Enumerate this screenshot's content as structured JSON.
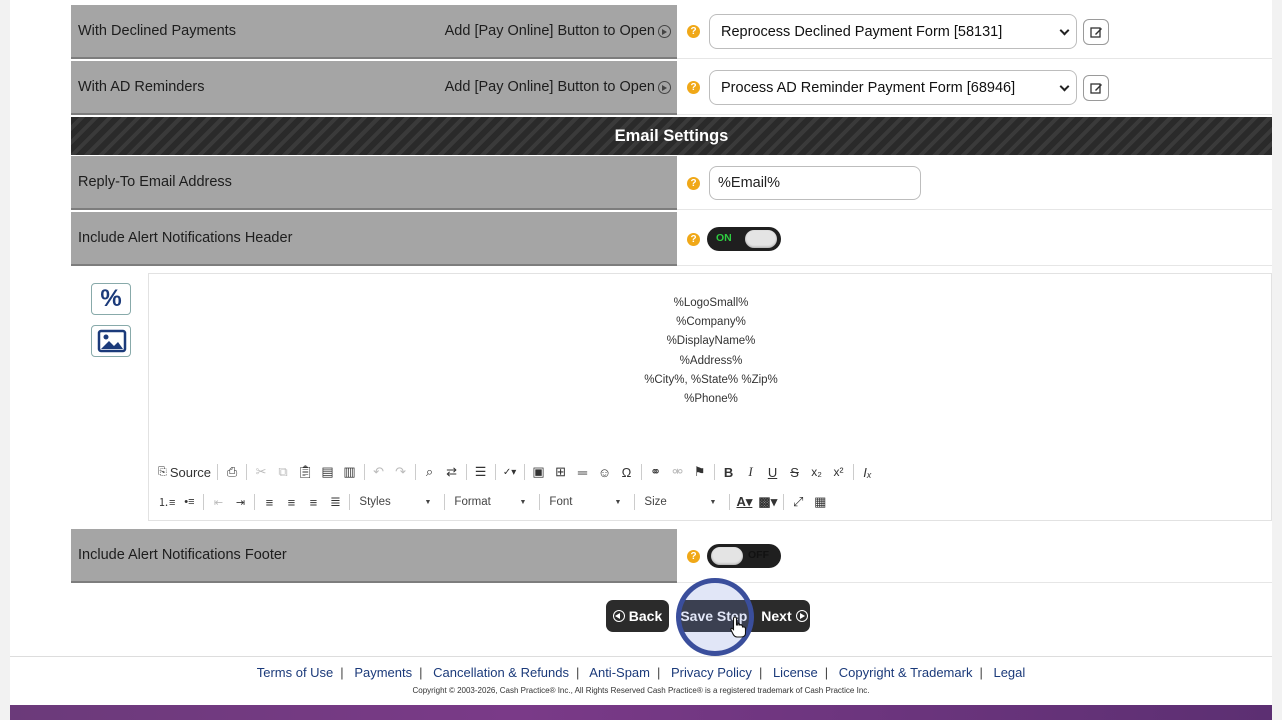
{
  "rows": {
    "declined": {
      "label": "With Declined Payments",
      "open_text": "Add [Pay Online] Button to Open",
      "select_value": "Reprocess Declined Payment Form [58131]"
    },
    "ad": {
      "label": "With AD Reminders",
      "open_text": "Add [Pay Online] Button to Open",
      "select_value": "Process AD Reminder Payment Form [68946]"
    }
  },
  "email_section": {
    "title": "Email Settings",
    "reply_to": {
      "label": "Reply-To Email Address",
      "value": "%Email%"
    },
    "header_toggle": {
      "label": "Include Alert Notifications Header",
      "state": "ON"
    },
    "footer_toggle": {
      "label": "Include Alert Notifications Footer",
      "state": "OFF"
    }
  },
  "help_glyph": "?",
  "side_icons": {
    "percent": "%"
  },
  "editor": {
    "lines": [
      "%LogoSmall%",
      "%Company%",
      "%DisplayName%",
      "%Address%",
      "%City%, %State% %Zip%",
      "%Phone%"
    ],
    "toolbar": {
      "source": "Source",
      "styles": "Styles",
      "format": "Format",
      "font": "Font",
      "size": "Size"
    }
  },
  "nav": {
    "back": "Back",
    "save": "Save Step",
    "next": "Next"
  },
  "footer": {
    "links": [
      "Terms of Use",
      "Payments",
      "Cancellation & Refunds",
      "Anti-Spam",
      "Privacy Policy",
      "License",
      "Copyright & Trademark",
      "Legal"
    ],
    "copyright": "Copyright © 2003-2026, Cash Practice® Inc., All Rights Reserved Cash Practice® is a registered trademark of Cash Practice Inc."
  },
  "colors": {
    "label_bg": "#a5a5a5",
    "help": "#f0a818",
    "toggle_on_text": "#2ecc40",
    "focus_ring": "#3a4e9c",
    "link": "#1b3a7a"
  }
}
